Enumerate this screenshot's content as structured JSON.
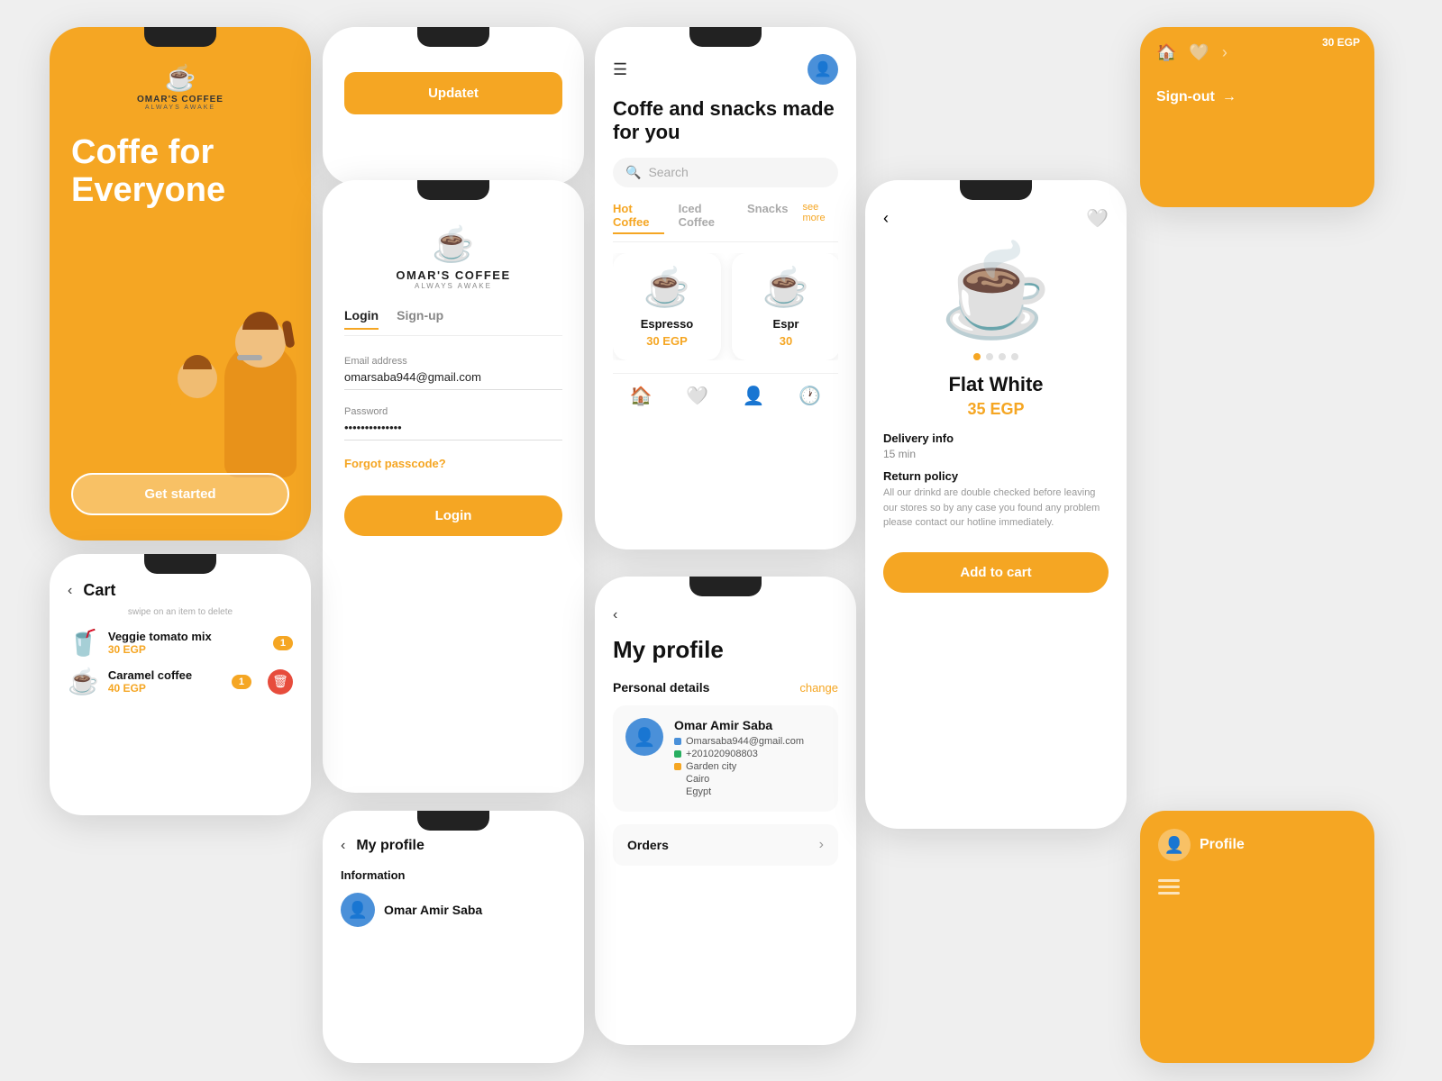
{
  "app": {
    "brand": {
      "name": "OMAR'S COFFEE",
      "tagline": "ALWAYS AWAKE",
      "icon": "☕"
    },
    "accent_color": "#F5A623"
  },
  "phone1": {
    "title": "Coffe for Everyone",
    "cta_label": "Get started"
  },
  "phone3": {
    "tabs": [
      "Login",
      "Sign-up"
    ],
    "active_tab": "Login",
    "email_label": "Email address",
    "email_value": "omarsaba944@gmail.com",
    "password_label": "Password",
    "password_value": "••••••••••••••",
    "forgot_label": "Forgot passcode?",
    "login_btn": "Login"
  },
  "phone2": {
    "update_btn": "Updatet"
  },
  "phone4": {
    "title": "Coffe and snacks made for you",
    "search_placeholder": "Search",
    "categories": [
      "Hot Coffee",
      "Iced Coffee",
      "Snacks"
    ],
    "active_category": "Hot Coffee",
    "see_more": "see more",
    "products": [
      {
        "name": "Espresso",
        "price": "30 EGP",
        "emoji": "☕"
      },
      {
        "name": "Espr",
        "price": "30",
        "emoji": "☕"
      }
    ]
  },
  "phone5": {
    "title": "My profile",
    "personal_details": "Personal details",
    "change": "change",
    "user": {
      "name": "Omar Amir Saba",
      "email": "Omarsaba944@gmail.com",
      "phone": "+201020908803",
      "city": "Garden city",
      "country1": "Cairo",
      "country2": "Egypt"
    },
    "orders_label": "Orders"
  },
  "phone6": {
    "product_name": "Flat White",
    "product_price": "35 EGP",
    "product_emoji": "☕",
    "delivery_title": "Delivery info",
    "delivery_val": "15 min",
    "return_title": "Return policy",
    "return_text": "All our drinkd are double checked before leaving our stores so by any case you found any problem please contact our hotline immediately.",
    "add_to_cart": "Add to cart"
  },
  "phone7": {
    "signout_label": "Sign-out",
    "price_badge": "30 EGP"
  },
  "phone8": {
    "profile_label": "Profile"
  },
  "phone9": {
    "title": "Cart",
    "swipe_hint": "swipe on an item to delete",
    "items": [
      {
        "name": "Veggie tomato mix",
        "price": "30 EGP",
        "qty": "1",
        "emoji": "🥤"
      },
      {
        "name": "Caramel coffee",
        "price": "40 EGP",
        "qty": "1",
        "emoji": "☕"
      }
    ]
  },
  "phone10": {
    "title": "My profile",
    "information_label": "Information",
    "user_name": "Omar Amir Saba"
  }
}
